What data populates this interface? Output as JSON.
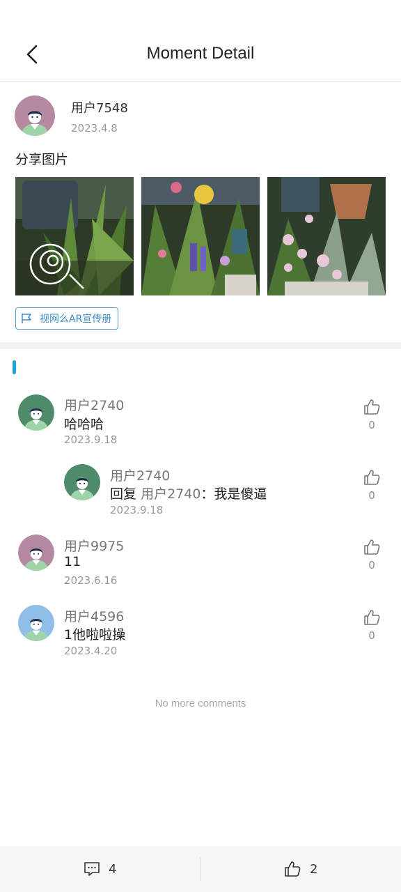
{
  "header": {
    "title": "Moment Detail"
  },
  "post": {
    "author": "用户7548",
    "date": "2023.4.8",
    "text": "分享图片",
    "photos": [
      "garden-photo-1",
      "garden-photo-2",
      "garden-photo-3"
    ],
    "tag_label": "视网么AR宣传册"
  },
  "comments": [
    {
      "user": "用户2740",
      "text": "哈哈哈",
      "date": "2023.9.18",
      "likes": "0",
      "avatar_bg": "#4f8a6a"
    },
    {
      "user": "用户2740",
      "reply_prefix": "回复",
      "reply_target": "用户2740",
      "reply_text": "：我是傻逼",
      "date": "2023.9.18",
      "likes": "0",
      "avatar_bg": "#4f8a6a"
    },
    {
      "user": "用户9975",
      "text": "11",
      "date": "2023.6.16",
      "likes": "0",
      "avatar_bg": "#b58aa0"
    },
    {
      "user": "用户4596",
      "text": "1他啦啦操",
      "date": "2023.4.20",
      "likes": "0",
      "avatar_bg": "#8fbfe8"
    }
  ],
  "footer_note": "No more comments",
  "bottom_bar": {
    "comment_count": "4",
    "like_count": "2"
  },
  "colors": {
    "accent": "#1aa3d9",
    "tag_border": "#4aa3d8",
    "post_avatar_bg": "#b58aa0"
  }
}
